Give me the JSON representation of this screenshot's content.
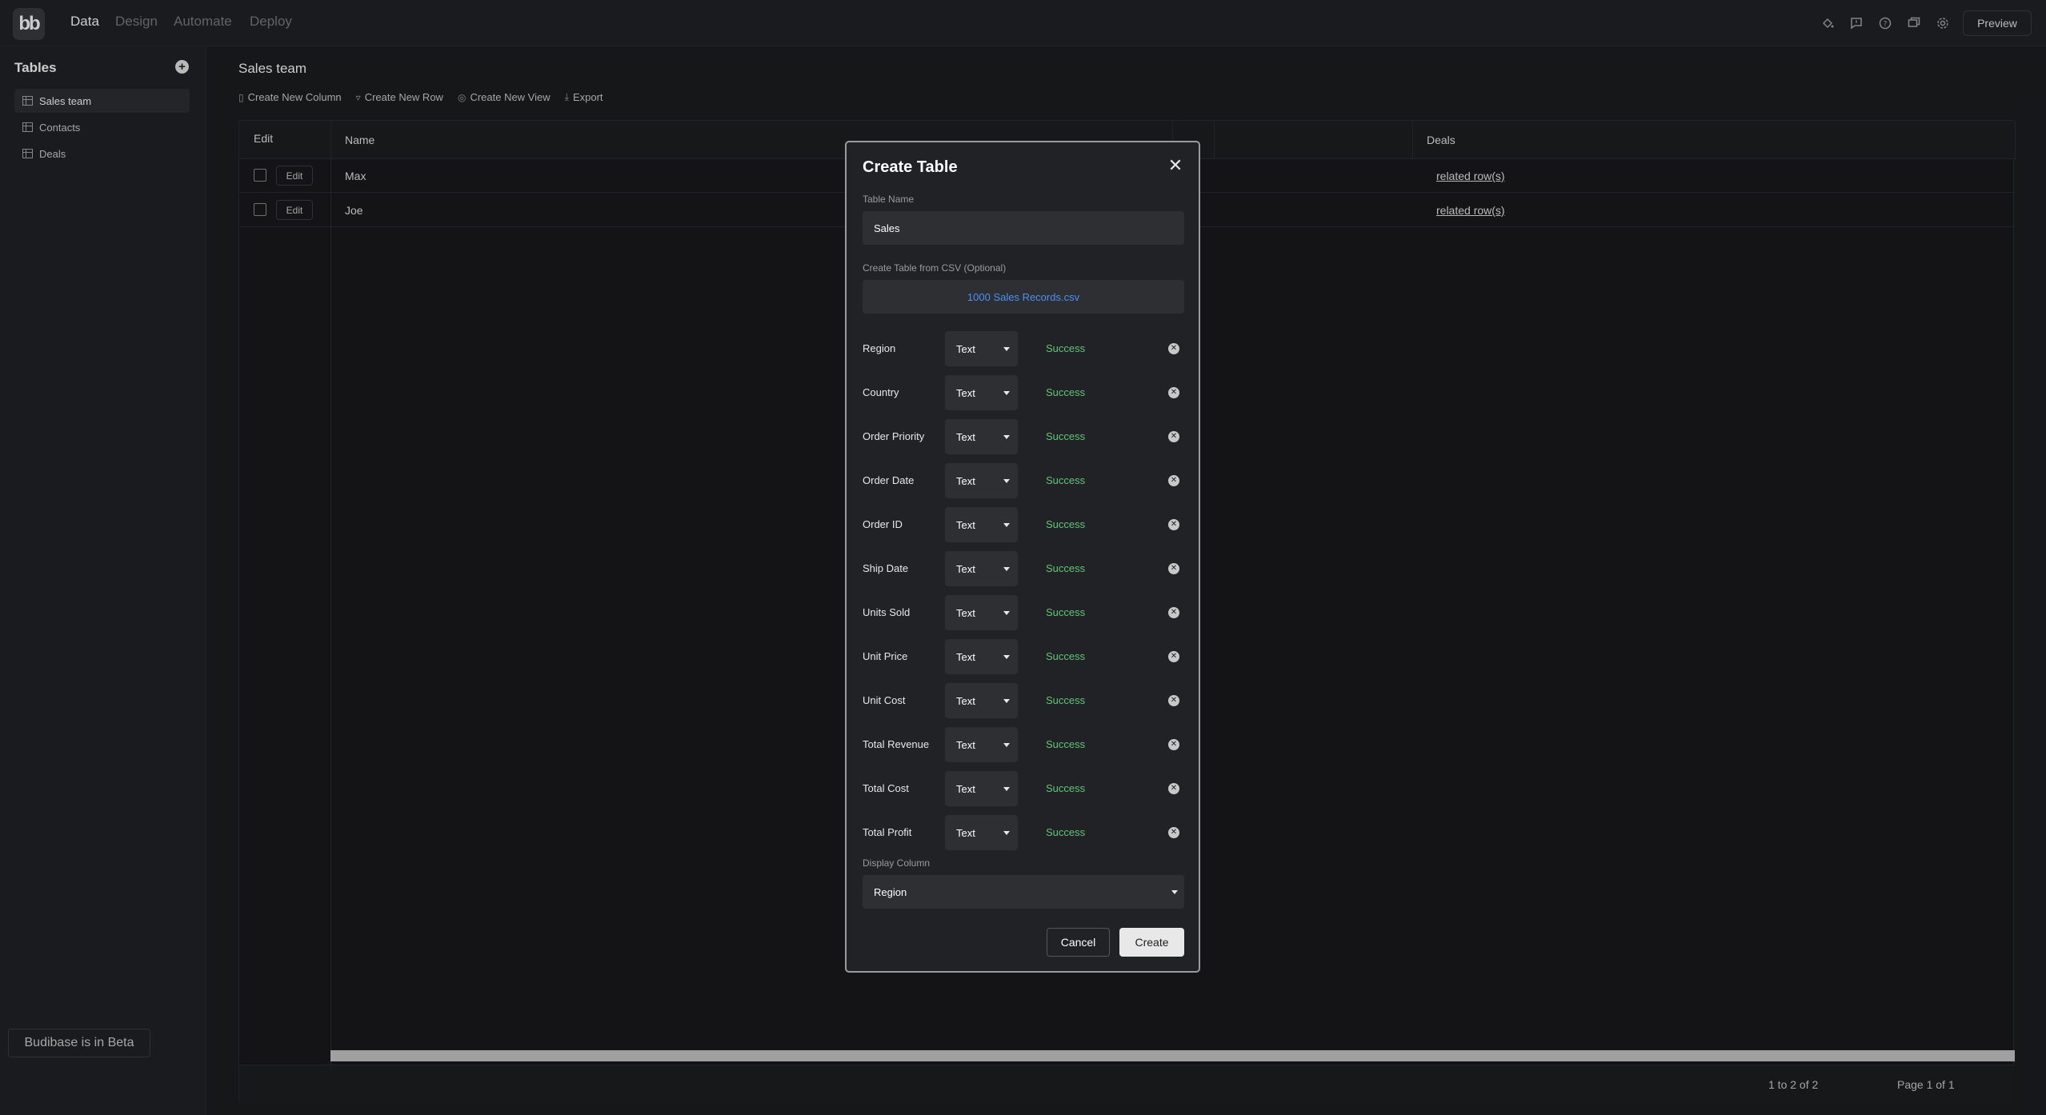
{
  "app": {
    "logo_text": "bb",
    "nav": [
      "Data",
      "Design",
      "Automate",
      "Deploy"
    ],
    "active_nav": "Data",
    "preview_label": "Preview"
  },
  "sidebar": {
    "title": "Tables",
    "items": [
      {
        "label": "Sales team",
        "selected": true
      },
      {
        "label": "Contacts",
        "selected": false
      },
      {
        "label": "Deals",
        "selected": false
      }
    ],
    "beta_label": "Budibase is in Beta"
  },
  "main": {
    "title": "Sales team",
    "toolbar": [
      "Create New Column",
      "Create New Row",
      "Create New View",
      "Export"
    ],
    "grid": {
      "headers": {
        "edit": "Edit",
        "name": "Name",
        "deals": "Deals"
      },
      "rows": [
        {
          "edit": "Edit",
          "name": "Max",
          "deals": "related row(s)"
        },
        {
          "edit": "Edit",
          "name": "Joe",
          "deals": "related row(s)"
        }
      ]
    },
    "footer": {
      "count": "1 to 2 of 2",
      "page": "Page 1 of 1"
    }
  },
  "modal": {
    "title": "Create Table",
    "name_label": "Table Name",
    "name_value": "Sales",
    "csv_label": "Create Table from CSV (Optional)",
    "csv_file": "1000 Sales Records.csv",
    "columns": [
      {
        "name": "Region",
        "type": "Text",
        "status": "Success"
      },
      {
        "name": "Country",
        "type": "Text",
        "status": "Success"
      },
      {
        "name": "Order Priority",
        "type": "Text",
        "status": "Success"
      },
      {
        "name": "Order Date",
        "type": "Text",
        "status": "Success"
      },
      {
        "name": "Order ID",
        "type": "Text",
        "status": "Success"
      },
      {
        "name": "Ship Date",
        "type": "Text",
        "status": "Success"
      },
      {
        "name": "Units Sold",
        "type": "Text",
        "status": "Success"
      },
      {
        "name": "Unit Price",
        "type": "Text",
        "status": "Success"
      },
      {
        "name": "Unit Cost",
        "type": "Text",
        "status": "Success"
      },
      {
        "name": "Total Revenue",
        "type": "Text",
        "status": "Success"
      },
      {
        "name": "Total Cost",
        "type": "Text",
        "status": "Success"
      },
      {
        "name": "Total Profit",
        "type": "Text",
        "status": "Success"
      }
    ],
    "display_label": "Display Column",
    "display_value": "Region",
    "cancel_label": "Cancel",
    "create_label": "Create"
  },
  "colors": {
    "success": "#62c47a",
    "link": "#4e8ef7",
    "background": "#1c1d20",
    "panel": "#212226"
  }
}
